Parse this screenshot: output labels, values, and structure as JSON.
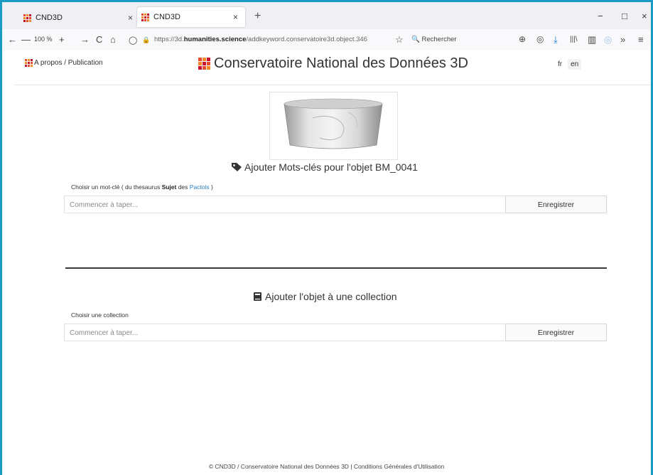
{
  "browser": {
    "tabs": [
      {
        "title": "CND3D",
        "close": "×"
      },
      {
        "title": "CND3D",
        "close": "×"
      }
    ],
    "new_tab": "+",
    "window_controls": {
      "minimize": "−",
      "maximize": "□",
      "close": "×"
    },
    "zoom": "100 %",
    "zoom_minus": "—",
    "zoom_plus": "+",
    "url": {
      "prefix": "https://3d.",
      "domain": "humanities.science",
      "path": "/addkeyword.conservatoire3d.object.346"
    },
    "search_placeholder": "Rechercher",
    "icons": {
      "back": "←",
      "forward": "→",
      "reload": "C",
      "home": "⌂",
      "shield": "◯",
      "lock": "🔒",
      "star": "☆",
      "search": "🔍",
      "library": "|||\\",
      "sidebar": "▥",
      "more": "»",
      "menu": "≡",
      "downloads": "⤓",
      "pocket": "◎",
      "account": "⊕"
    }
  },
  "page": {
    "about_link": "A propos / Publication",
    "site_title": "Conservatoire National des Données 3D",
    "languages": [
      "fr",
      "en"
    ],
    "keywords": {
      "heading": "Ajouter Mots-clés pour l'objet BM_0041",
      "label_prefix": "Choisir un mot-clé ( du thesaurus ",
      "label_bold": "Sujet",
      "label_mid": " des ",
      "label_link": "Pactols",
      "label_suffix": " )",
      "placeholder": "Commencer à taper...",
      "button": "Enregistrer"
    },
    "collection": {
      "heading": "Ajouter l'objet à une collection",
      "label": "Choisir une collection",
      "placeholder": "Commencer à taper...",
      "button": "Enregistrer"
    },
    "footer": "© CND3D / Conservatoire National des Données 3D | Conditions Générales d'Utilisation"
  },
  "colors": {
    "accent_border": "#1a9bc4",
    "logo": [
      "#e84b2b",
      "#f08a24",
      "#c8102e"
    ],
    "link": "#2a7fc1"
  }
}
